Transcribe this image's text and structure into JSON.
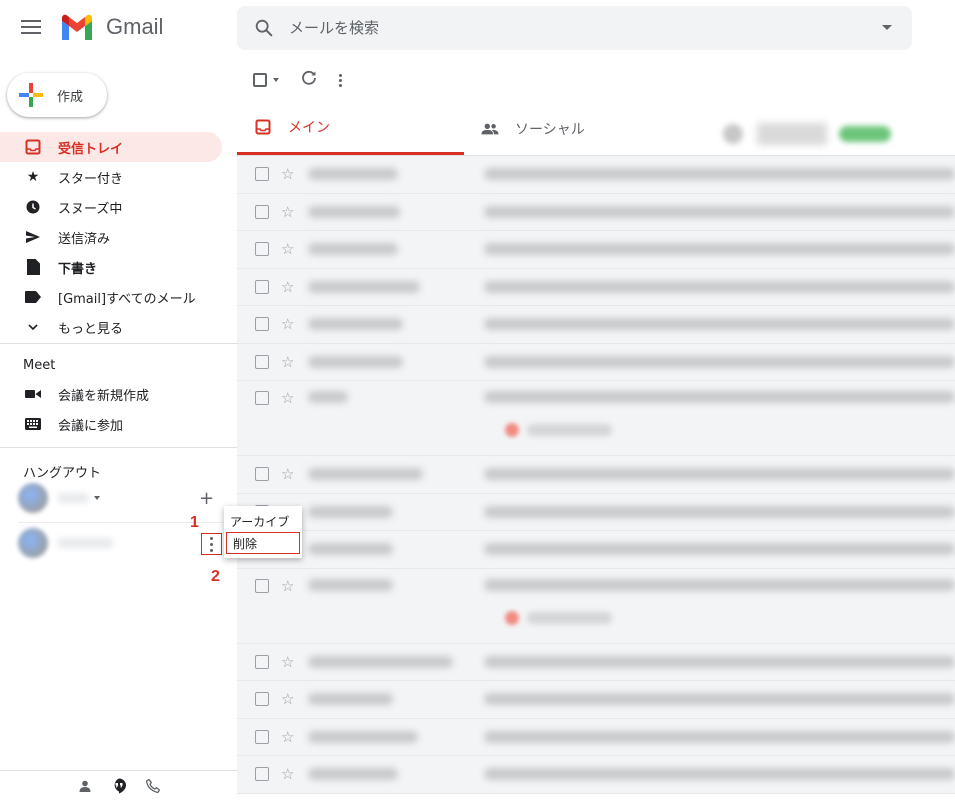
{
  "app": {
    "name": "Gmail",
    "accent_color": "#d93025"
  },
  "search": {
    "placeholder": "メールを検索"
  },
  "compose": {
    "label": "作成"
  },
  "sidebar": {
    "items": [
      {
        "label": "受信トレイ",
        "icon": "inbox-icon",
        "active": true
      },
      {
        "label": "スター付き",
        "icon": "star-icon"
      },
      {
        "label": "スヌーズ中",
        "icon": "clock-icon"
      },
      {
        "label": "送信済み",
        "icon": "send-icon"
      },
      {
        "label": "下書き",
        "icon": "draft-icon",
        "bold": true
      },
      {
        "label": "[Gmail]すべてのメール",
        "icon": "label-icon"
      },
      {
        "label": "もっと見る",
        "icon": "chevron-down-icon"
      }
    ],
    "meet": {
      "title": "Meet",
      "items": [
        {
          "label": "会議を新規作成",
          "icon": "video-icon"
        },
        {
          "label": "会議に参加",
          "icon": "keyboard-icon"
        }
      ]
    },
    "hangouts": {
      "title": "ハングアウト"
    }
  },
  "annotations": {
    "step1": "1",
    "step2": "2"
  },
  "context_menu": {
    "items": [
      "アーカイブ",
      "削除"
    ],
    "highlighted": "削除"
  },
  "tabs": [
    {
      "label": "メイン",
      "icon": "inbox-icon",
      "active": true
    },
    {
      "label": "ソーシャル",
      "icon": "people-icon"
    }
  ],
  "mail_list": {
    "row_count": 17,
    "blurred": true
  }
}
